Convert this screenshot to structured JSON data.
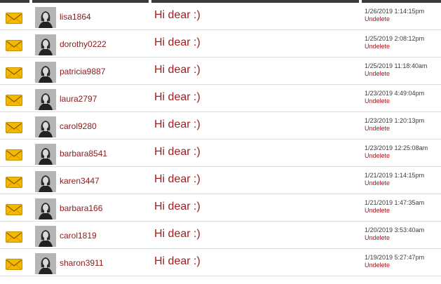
{
  "header": {},
  "messages": [
    {
      "username": "lisa1864",
      "subject": "Hi dear :)",
      "date": "1/26/2019 1:14:15pm",
      "action": "Undelete"
    },
    {
      "username": "dorothy0222",
      "subject": "Hi dear :)",
      "date": "1/25/2019 2:08:12pm",
      "action": "Undelete"
    },
    {
      "username": "patricia9887",
      "subject": "Hi dear :)",
      "date": "1/25/2019 11:18:40am",
      "action": "Undelete"
    },
    {
      "username": "laura2797",
      "subject": "Hi dear :)",
      "date": "1/23/2019 4:49:04pm",
      "action": "Undelete"
    },
    {
      "username": "carol9280",
      "subject": "Hi dear :)",
      "date": "1/23/2019 1:20:13pm",
      "action": "Undelete"
    },
    {
      "username": "barbara8541",
      "subject": "Hi dear :)",
      "date": "1/23/2019 12:25:08am",
      "action": "Undelete"
    },
    {
      "username": "karen3447",
      "subject": "Hi dear :)",
      "date": "1/21/2019 1:14:15pm",
      "action": "Undelete"
    },
    {
      "username": "barbara166",
      "subject": "Hi dear :)",
      "date": "1/21/2019 1:47:35am",
      "action": "Undelete"
    },
    {
      "username": "carol1819",
      "subject": "Hi dear :)",
      "date": "1/20/2019 3:53:40am",
      "action": "Undelete"
    },
    {
      "username": "sharon3911",
      "subject": "Hi dear :)",
      "date": "1/19/2019 5:27:47pm",
      "action": "Undelete"
    }
  ],
  "icons": {
    "message": "envelope-icon",
    "avatar": "user-avatar"
  },
  "colors": {
    "username": "#8b1a1a",
    "subject": "#a02020",
    "undelete": "#b5121b",
    "envelope": "#f5b800",
    "header_bar": "#3a3a3a"
  }
}
